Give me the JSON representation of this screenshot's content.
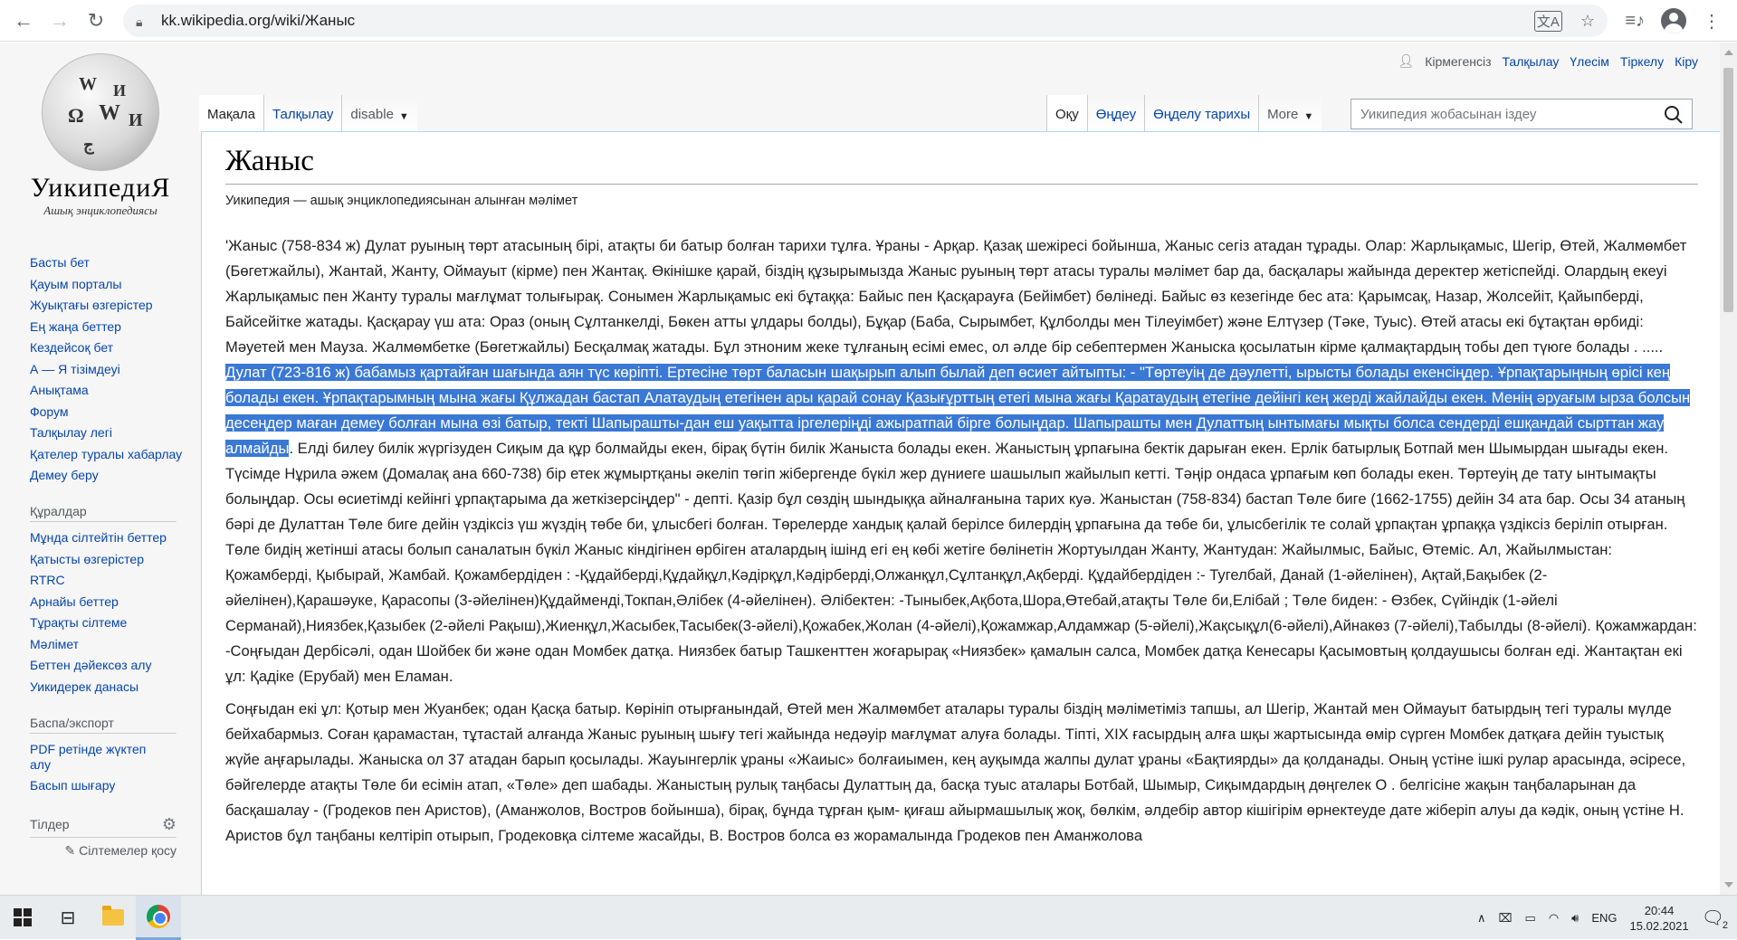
{
  "browser": {
    "url": "kk.wikipedia.org/wiki/Жаныс"
  },
  "logo": {
    "title": "УикипедиЯ",
    "subtitle": "Ашық энциклопедиясы"
  },
  "sidebar": {
    "main": [
      "Басты бет",
      "Қауым порталы",
      "Жуықтағы өзгерістер",
      "Ең жаңа беттер",
      "Кездейсоқ бет",
      "А — Я тізімдеуі",
      "Анықтама",
      "Форум",
      "Талқылау легі",
      "Қателер туралы хабарлау",
      "Демеу беру"
    ],
    "tools_heading": "Құралдар",
    "tools": [
      "Мұнда сілтейтін беттер",
      "Қатысты өзгерістер",
      "RTRC",
      "Арнайы беттер",
      "Тұрақты сілтеме",
      "Мәлімет",
      "Беттен дәйексөз алу",
      "Уикидерек данасы"
    ],
    "print_heading": "Баспа/экспорт",
    "print": [
      "PDF ретінде жүктеп алу",
      "Басып шығару"
    ],
    "langs_heading": "Тілдер",
    "add_links": "Сілтемелер қосу"
  },
  "personal": {
    "not_logged": "Кірмегенсіз",
    "talk": "Талқылау",
    "contrib": "Үлесім",
    "register": "Тіркелу",
    "login": "Кіру"
  },
  "tabs": {
    "article": "Мақала",
    "talk": "Талқылау",
    "variant": "disable",
    "read": "Оқу",
    "edit": "Өңдеу",
    "history": "Өңделу тарихы",
    "more": "More"
  },
  "search": {
    "placeholder": "Уикипедия жобасынан іздеу"
  },
  "article": {
    "title": "Жаныс",
    "site_sub": "Уикипедия — ашық энциклопедиясынан алынған мәлімет",
    "p1_before": "'Жаныс (758-834 ж) Дулат руының төрт атасының бірі, атақты би батыр болған тарихи тұлға. Ұраны - Арқар. Қазақ шежіресі бойынша, Жаныс сегіз атадан тұрады. Олар: Жарлықамыс, Шегір, Өтей, Жалмөмбет (Бөгетжайлы), Жантай, Жанту, Оймауыт (кірме) пен Жантақ. Өкінішке қарай, біздің құзырымызда Жаныс руының төрт атасы туралы мәлімет бар да, басқалары жайында деректер жетіспейді. Олардың екеуі Жарлықамыс пен Жанту туралы мағлұмат толығырақ. Сонымен Жарлықамыс екі бұтаққа: Байыс пен Қасқарауға (Бейімбет) бөлінеді. Байыс өз кезегінде бес ата: Қарымсақ, Назар, Жолсейіт, Қайыпберді, Байсейітке жатады. Қасқарау үш ата: Ораз (оның Сұлтанкелді, Бөкен атты ұлдары болды), Бұқар (Баба, Сырымбет, Құлболды мен Тілеуімбет) және Елтүзер (Тәке, Туыс). Өтей атасы екі бұтақтан өрбиді: Мәуетей мен Мауза. Жалмөмбетке (Бөгетжайлы) Бесқалмақ жатады. Бұл этноним жеке тұлғаның есімі емес, ол әлде бір себептермен Жаныска қосылатын кірме қалмақтардың тобы деп түюге болады . ..... ",
    "p1_highlight": "Дулат (723-816 ж) бабамыз қартайған шағында аян түс көріпті. Ертесіне төрт баласын шақырып алып былай деп өсиет айтыпты: - \"Төртеуің де дәулетті, ырысты болады екенсіңдер. Ұрпақтарыңның өрісі кең болады екен. Ұрпақтарымның мына жағы Құлжадан бастап Алатаудың етегінен ары қарай сонау Қазығұрттың етегі мына жағы Қаратаудың етегіне дейінгі кең жерді жайлайды екен. Менің әруағым ырза болсын десеңдер маған демеу болған мына өзі батыр, текті Шапырашты-дан еш уақытта іргелеріңді ажыратпай бірге болыңдар. Шапырашты мен Дулаттың ынтымағы мықты болса сендерді ешқандай сырттан жау алмайды",
    "p1_after": ". Елді билеу билік жүргізуден Сиқым да құр болмайды екен, бірақ бүтін билік Жаныста болады екен. Жаныстың ұрпағына бектік дарыған екен. Ерлік батырлық Ботпай мен Шымырдан шығады екен. Түсімде Нұрила әжем (Домалақ ана 660-738) бір етек жұмыртқаны әкеліп төгіп жібергенде бүкіл жер дүниеге шашылып жайылып кетті. Тәңір ондаса ұрпағым көп болады екен. Төртеуің де тату ынтымақты болыңдар. Осы өсиетімді кейінгі ұрпақтарыма да жеткізерсіңдер\" - депті. Қазір бұл сөздің шындыққа айналғанына тарих куә. Жаныстан (758-834) бастап Төле биге (1662-1755) дейін 34 ата бар. Осы 34 атаның бәрі де Дулаттан Төле биге дейін үздіксіз үш жүздің төбе би, ұлысбегі болған. Төрелерде хандық қалай берілсе билердің ұрпағына да төбе би, ұлысбегілік те солай ұрпақтан ұрпаққа үздіксіз беріліп отырған. Төле бидің жетінші атасы болып саналатын бүкіл Жаныс кіндігінен өрбіген аталардың ішінд егі ең көбі жетіге бөлінетін Жортуылдан Жанту, Жантудан: Жайылмыс, Байыс, Өтеміс. Ал, Жайылмыстан: Қожамберді, Қыбырай, Жамбай. Қожамбердіден : -Құдайберді,Құдайқұл,Кәдірқұл,Кәдірберді,Олжанқұл,Сұлтанқұл,Ақберді. Құдайбердіден :- Тугелбай, Данай (1-әйелінен), Ақтай,Бақыбек (2-әйелінен),Қарашәуке, Қарасопы (3-әйелінен)Құдайменді,Токпан,Әлібек (4-әйелінен). Әлібектен: -Тыныбек,Ақбота,Шора,Өтебай,атақты Төле би,Елібай ; Төле биден: - Өзбек, Сүйіндік (1-әйелі Серманай),Ниязбек,Қазыбек (2-әйелі Рақыш),Жиенқұл,Жасыбек,Тасыбек(3-әйелі),Қожабек,Жолан (4-әйелі),Қожамжар,Алдамжар (5-әйелі),Жақсықұл(6-әйелі),Айнакөз (7-әйелі),Табылды (8-әйелі). Қожамжардан: -Соңғыдан Дербісәлі, одан Шойбек би және одан Момбек датқа. Ниязбек батыр Ташкенттен жоғарырақ «Ниязбек» қамалын салса, Момбек датқа Кенесары Қасымовтың қолдаушысы болған еді. Жантақтан екі ұл: Қадіке (Ерубай) мен Еламан.",
    "p2": "Соңғыдан екі ұл: Қотыр мен Жуанбек; одан Қасқа батыр. Көрініп отырғанындай, Өтей мен Жалмөмбет аталары туралы біздің мәліметіміз тапшы, ал Шегір, Жантай мен Оймауыт батырдың тегі туралы мүлде бейхабармыз. Соған қарамастан, тұтастай алғанда Жаныс руының шығу тегі жайында недәуір мағлұмат алуға болады. Тіпті, XIX ғасырдың алға шқы жартысында өмір сүрген Момбек датқаға дейін туыстық жүйе аңғарылады. Жаныска ол 37 атадан барып қосылады. Жауынгерлік ұраны «Жаиыс» болғаиымен, кең ауқымда жалпы дулат ұраны «Бақтиярды» да қолданады. Оның үстіне ішкі рулар арасында, әсіресе, бәйгелерде атақты Төле би есімін атап, «Төле» деп шабады. Жаныстың рулық таңбасы Дулаттың да, басқа туыс аталары Ботбай, Шымыр, Сиқымдардың дөңгелек О . белгісіне жақын таңбаларынан да басқашалау - (Гродеков пен Аристов), (Аманжолов, Востров бойынша), бірақ, бұнда тұрған қым- қиғаш айырмашылық жоқ, бөлкім, әлдебір автор кішігірім өрнектеуде дате жіберіп алуы да кәдік, оның үстіне Н. Аристов бұл таңбаны келтіріп отырып, Гродековқа сілтеме жасайды, В. Востров болса өз жорамалында Гродеков пен Аманжолова"
  },
  "taskbar": {
    "lang": "ENG",
    "time": "20:44",
    "date": "15.02.2021",
    "notif_count": "2"
  }
}
